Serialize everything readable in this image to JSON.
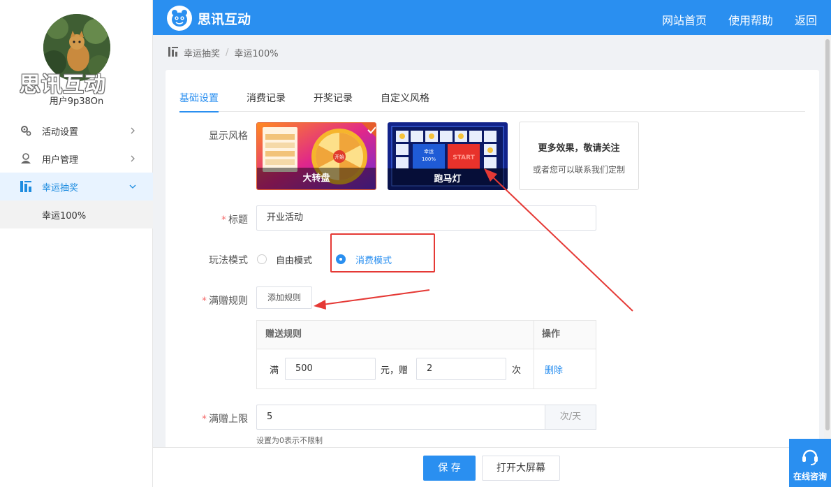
{
  "sidebar": {
    "watermark": "思讯互动",
    "user_name": "用户9p38On",
    "items": [
      {
        "label": "活动设置"
      },
      {
        "label": "用户管理"
      },
      {
        "label": "幸运抽奖"
      }
    ],
    "sub_item": "幸运100%"
  },
  "header": {
    "app_title": "思讯互动",
    "links": [
      "网站首页",
      "使用帮助",
      "返回"
    ]
  },
  "breadcrumb": {
    "parent": "幸运抽奖",
    "separator": "/",
    "current": "幸运100%"
  },
  "tabs": [
    "基础设置",
    "消费记录",
    "开奖记录",
    "自定义风格"
  ],
  "form": {
    "style_label": "显示风格",
    "styles": [
      {
        "caption": "大转盘",
        "selected": true
      },
      {
        "caption": "跑马灯",
        "selected": false
      }
    ],
    "more_title": "更多效果，敬请关注",
    "more_sub": "或者您可以联系我们定制",
    "title_label": "标题",
    "title_value": "开业活动",
    "mode_label": "玩法模式",
    "mode_options": [
      "自由模式",
      "消费模式"
    ],
    "mode_selected": "消费模式",
    "rule_label": "满赠规则",
    "add_rule_button": "添加规则",
    "rule_table": {
      "headers": [
        "赠送规则",
        "操作"
      ],
      "row": {
        "prefix": "满",
        "amount": "500",
        "middle": "元，赠",
        "times": "2",
        "suffix": "次",
        "action": "删除"
      }
    },
    "limit_label": "满赠上限",
    "limit_value": "5",
    "limit_unit": "次/天",
    "limit_hint": "设置为0表示不限制"
  },
  "footer": {
    "save": "保 存",
    "open_bigscreen": "打开大屏幕"
  },
  "online_consult": "在线咨询",
  "thumb_text": {
    "wheel_start": "开始",
    "marquee_center_1": "幸运",
    "marquee_center_2": "100%",
    "marquee_start": "START"
  },
  "colors": {
    "primary": "#2a8ff0",
    "required": "#f56c6c",
    "annotation": "#e53935"
  }
}
